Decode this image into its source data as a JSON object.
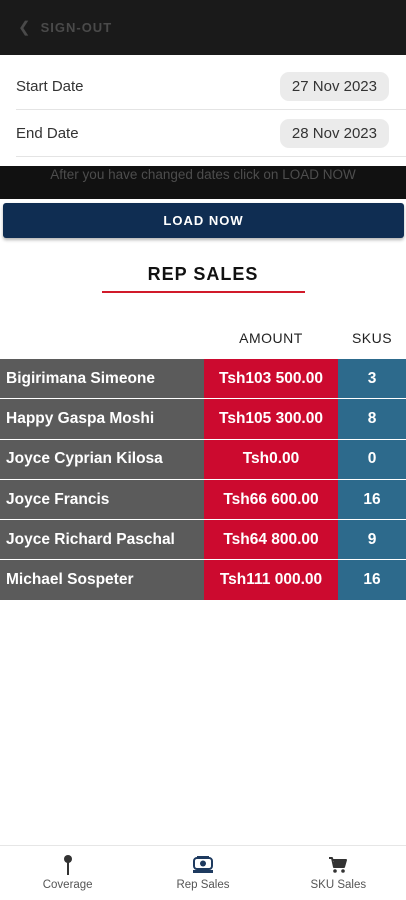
{
  "header": {
    "back_icon": "chevron-left-icon",
    "signout_label": "SIGN-OUT"
  },
  "dates": {
    "start_label": "Start Date",
    "start_value": "27 Nov 2023",
    "end_label": "End Date",
    "end_value": "28 Nov 2023"
  },
  "hint": "After you have changed dates click on LOAD NOW",
  "load_button": "LOAD NOW",
  "section_title": "REP SALES",
  "table": {
    "headers": {
      "amount": "AMOUNT",
      "skus": "SKUS"
    },
    "rows": [
      {
        "name": "Bigirimana Simeone",
        "amount": "Tsh103 500.00",
        "skus": "3"
      },
      {
        "name": "Happy Gaspa Moshi",
        "amount": "Tsh105 300.00",
        "skus": "8"
      },
      {
        "name": "Joyce Cyprian Kilosa",
        "amount": "Tsh0.00",
        "skus": "0"
      },
      {
        "name": "Joyce Francis",
        "amount": "Tsh66 600.00",
        "skus": "16"
      },
      {
        "name": "Joyce Richard Paschal",
        "amount": "Tsh64 800.00",
        "skus": "9"
      },
      {
        "name": "Michael Sospeter",
        "amount": "Tsh111 000.00",
        "skus": "16"
      }
    ]
  },
  "nav": {
    "items": [
      {
        "label": "Coverage",
        "icon": "map-pin-icon"
      },
      {
        "label": "Rep Sales",
        "icon": "register-icon"
      },
      {
        "label": "SKU Sales",
        "icon": "cart-icon"
      }
    ]
  },
  "colors": {
    "name_cell": "#5b5b5b",
    "amount_cell": "#cc0a2f",
    "skus_cell": "#2d6a8c",
    "load_button": "#0f2d52",
    "title_underline": "#d11a2a"
  }
}
